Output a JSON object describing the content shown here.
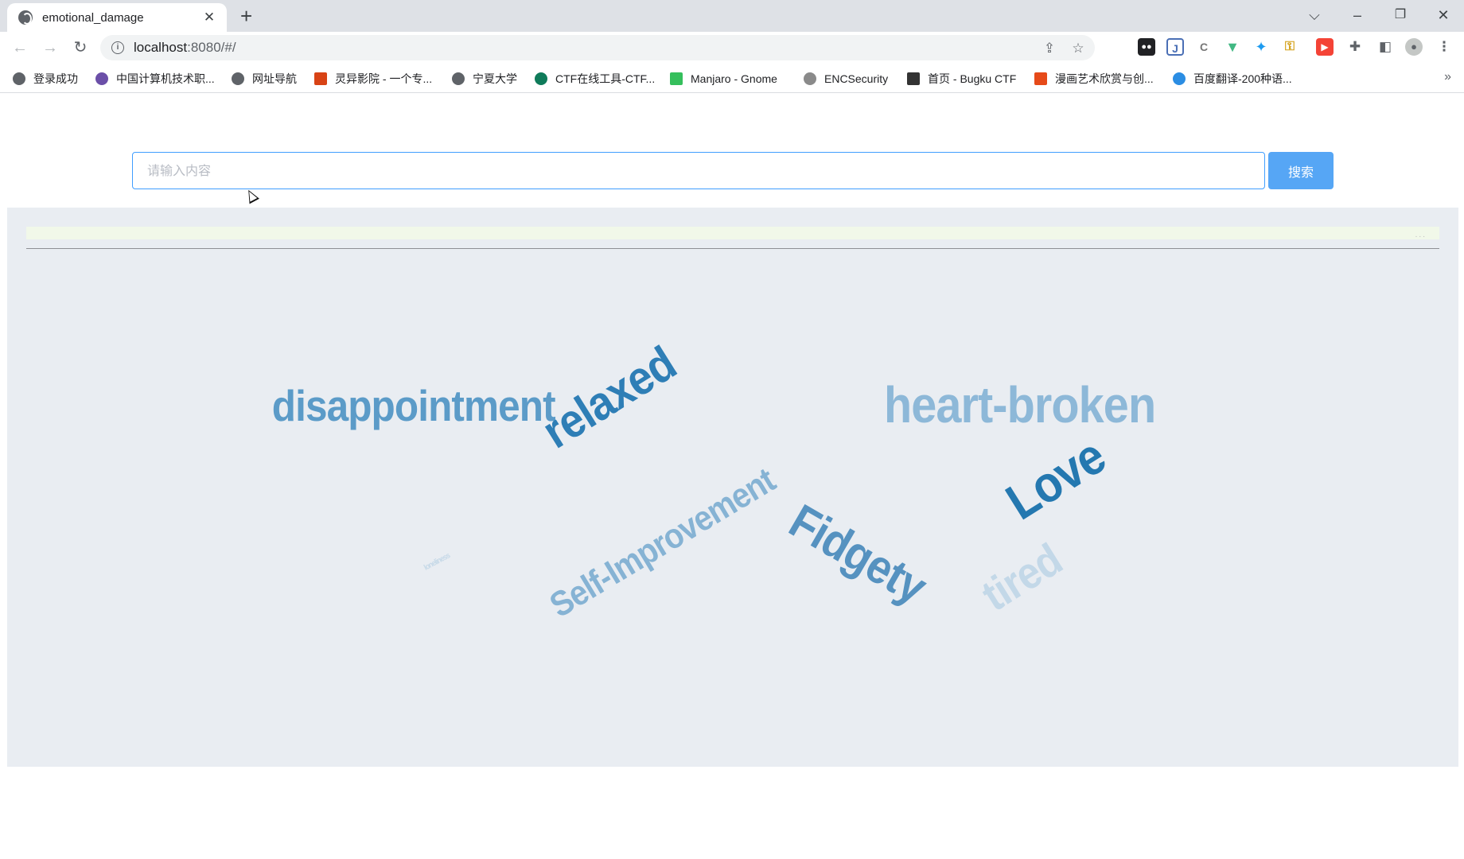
{
  "browser": {
    "tab_title": "emotional_damage",
    "tab_close": "✕",
    "new_tab": "+",
    "url_host": "localhost",
    "url_rest": ":8080/#/",
    "window_controls": {
      "dropdown": "⌵",
      "minimize": "–",
      "restore": "❐",
      "close": "✕"
    }
  },
  "bookmarks": [
    {
      "label": "登录成功"
    },
    {
      "label": "中国计算机技术职..."
    },
    {
      "label": "网址导航"
    },
    {
      "label": "灵异影院 - 一个专..."
    },
    {
      "label": "宁夏大学"
    },
    {
      "label": "CTF在线工具-CTF..."
    },
    {
      "label": "Manjaro - Gnome"
    },
    {
      "label": "ENCSecurity"
    },
    {
      "label": "首页 - Bugku CTF"
    },
    {
      "label": "漫画艺术欣赏与创..."
    },
    {
      "label": "百度翻译-200种语..."
    }
  ],
  "bookmarks_more": "»",
  "search": {
    "placeholder": "请输入内容",
    "value": "",
    "button_label": "搜索"
  },
  "progress": {
    "dots": "..."
  },
  "word_cloud": [
    {
      "text": "disappointment",
      "color": "#5b9bc8"
    },
    {
      "text": "relaxed",
      "color": "#2e7eb6"
    },
    {
      "text": "heart-broken",
      "color": "#8db8d8"
    },
    {
      "text": "Love",
      "color": "#2478b0"
    },
    {
      "text": "Self-Improvement",
      "color": "#86b3d4"
    },
    {
      "text": "Fidgety",
      "color": "#5692c0"
    },
    {
      "text": "tired",
      "color": "#c3d8e8"
    },
    {
      "text": "loneliness",
      "color": "#c6d9e8"
    }
  ]
}
